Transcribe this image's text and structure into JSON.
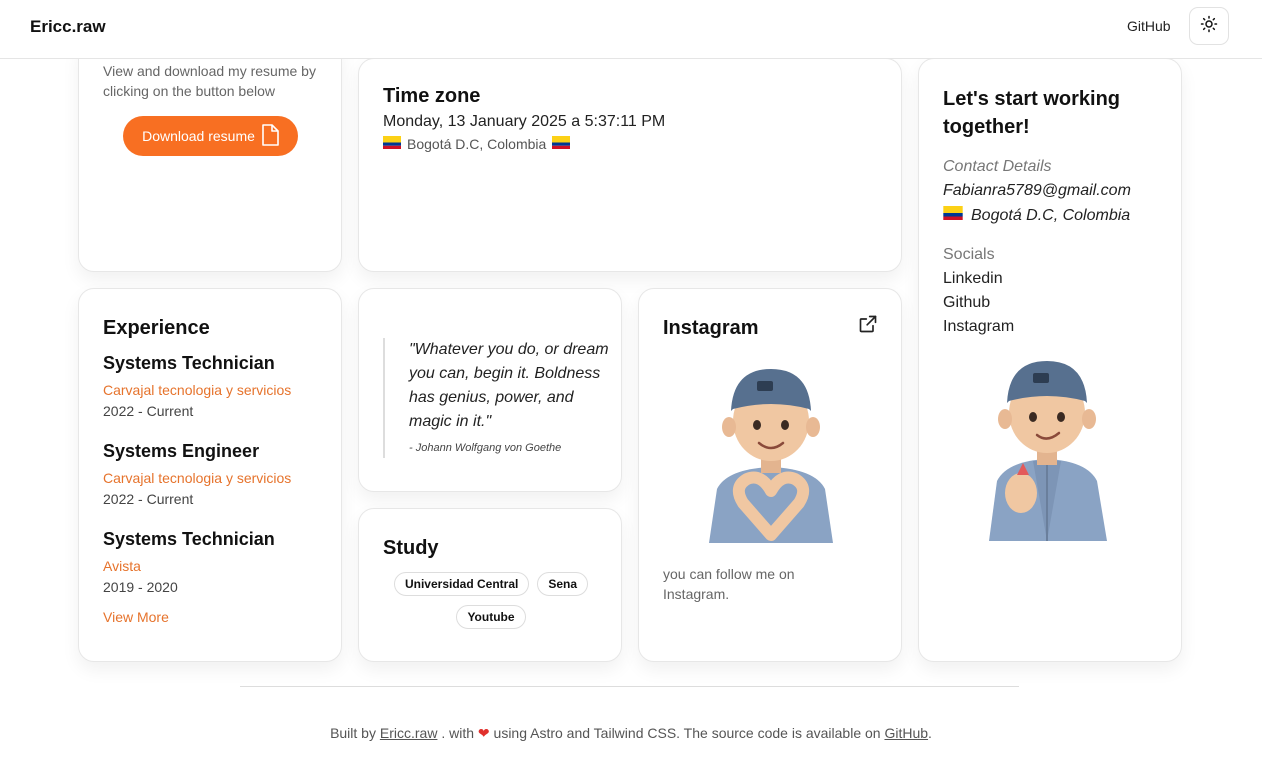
{
  "header": {
    "brand": "Ericc.raw",
    "github_link": "GitHub",
    "theme_icon": "sun-icon"
  },
  "resume": {
    "description": "View and download my resume by clicking on the button below",
    "button_label": "Download resume",
    "button_icon": "file-icon",
    "accent": "#f86f22"
  },
  "timezone": {
    "title": "Time zone",
    "datetime": "Monday, 13 January 2025 a 5:37:11 PM",
    "location": "Bogotá D.C, Colombia",
    "flag_icon": "colombia-flag-icon"
  },
  "contact": {
    "title": "Let's start working together!",
    "details_label": "Contact Details",
    "email": "Fabianra5789@gmail.com",
    "location": "Bogotá D.C, Colombia",
    "socials_label": "Socials",
    "socials": [
      "Linkedin",
      "Github",
      "Instagram"
    ]
  },
  "experience": {
    "title": "Experience",
    "jobs": [
      {
        "title": "Systems Technician",
        "company": "Carvajal tecnologia y servicios",
        "dates": "2022 - Current"
      },
      {
        "title": "Systems Engineer",
        "company": "Carvajal tecnologia y servicios",
        "dates": "2022 - Current"
      },
      {
        "title": "Systems Technician",
        "company": "Avista",
        "dates": "2019 - 2020"
      }
    ],
    "view_more": "View More",
    "accent": "#e6732c"
  },
  "quote": {
    "text": "\"Whatever you do, or dream you can, begin it. Boldness has genius, power, and magic in it.\"",
    "author": "- Johann Wolfgang von Goethe"
  },
  "study": {
    "title": "Study",
    "items": [
      "Universidad Central",
      "Sena",
      "Youtube"
    ]
  },
  "instagram": {
    "title": "Instagram",
    "link_icon": "external-link-icon",
    "avatar_icon": "memoji-heart-hands-icon",
    "description": "you can follow me on Instagram."
  },
  "contact_avatar_icon": "memoji-finger-heart-icon",
  "footer": {
    "prefix": "Built by",
    "author_link": "Ericc.raw",
    "middle": ". with",
    "heart_icon": "heart-icon",
    "suffix": "using Astro and Tailwind CSS. The source code is available on",
    "source_link": "GitHub",
    "end": "."
  }
}
